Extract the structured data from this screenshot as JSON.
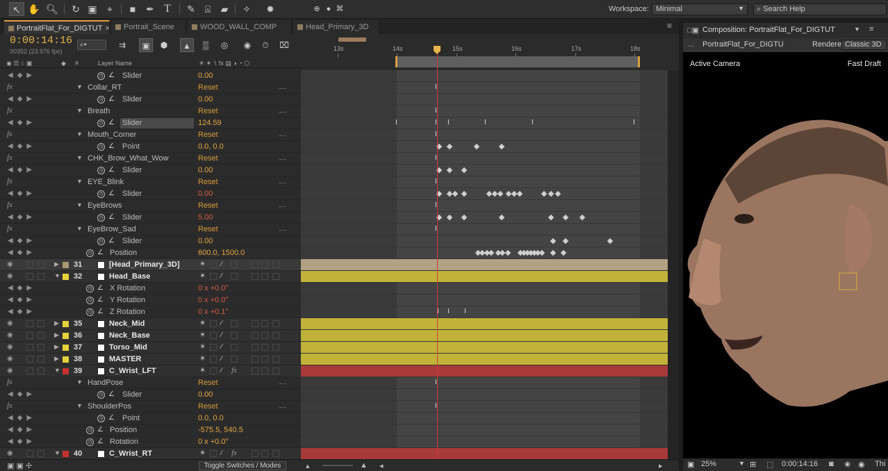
{
  "toolbar": {
    "tools": [
      "selection-tool",
      "hand-tool",
      "zoom-tool",
      "rotate-tool",
      "camera-tool",
      "pan-behind-tool",
      "rectangle-tool",
      "pen-tool",
      "type-tool",
      "brush-tool",
      "clone-stamp-tool",
      "eraser-tool",
      "roto-brush-tool",
      "puppet-pin-tool"
    ],
    "type_glyph": "T",
    "workspace_label": "Workspace:",
    "workspace_value": "Minimal",
    "search_help": "Search Help"
  },
  "tabs": [
    {
      "label": "PortraitFlat_For_DIGTUT",
      "active": true,
      "close": "×"
    },
    {
      "label": "Portrait_Scene"
    },
    {
      "label": "WOOD_WALL_COMP"
    },
    {
      "label": "Head_Primary_3D"
    }
  ],
  "timecode": "0:00:14:16",
  "timecode_sub": "00352 (23.976 fps)",
  "search_placeholder": "",
  "columns": {
    "hash": "#",
    "layer_name": "Layer Name"
  },
  "ruler": {
    "labels": [
      "13s",
      "14s",
      "15s",
      "16s",
      "17s",
      "18s"
    ]
  },
  "rows": [
    {
      "kind": "prop",
      "name": "Slider",
      "value": "0.00",
      "indent": 3,
      "graph": true,
      "stop": true
    },
    {
      "kind": "fx",
      "name": "Collar_RT",
      "value": "Reset"
    },
    {
      "kind": "prop",
      "name": "Slider",
      "value": "0.00",
      "indent": 3,
      "graph": true,
      "stop": true
    },
    {
      "kind": "fx",
      "name": "Breath",
      "value": "Reset"
    },
    {
      "kind": "prop",
      "name": "Slider",
      "value": "124.59",
      "indent": 3,
      "graph": true,
      "stop": true,
      "selected": true
    },
    {
      "kind": "fx",
      "name": "Mouth_Corner",
      "value": "Reset"
    },
    {
      "kind": "prop",
      "name": "Point",
      "value": "0.0, 0.0",
      "indent": 3,
      "graph": true,
      "stop": true
    },
    {
      "kind": "fx",
      "name": "CHK_Brow_What_Wow",
      "value": "Reset"
    },
    {
      "kind": "prop",
      "name": "Slider",
      "value": "0.00",
      "indent": 3,
      "graph": true,
      "stop": true
    },
    {
      "kind": "fx",
      "name": "EYE_Blink",
      "value": "Reset"
    },
    {
      "kind": "prop",
      "name": "Slider",
      "value": "0.00",
      "indent": 3,
      "graph": true,
      "stop": true,
      "red": true
    },
    {
      "kind": "fx",
      "name": "EyeBrows",
      "value": "Reset"
    },
    {
      "kind": "prop",
      "name": "Slider",
      "value": "5.00",
      "indent": 3,
      "graph": true,
      "stop": true,
      "red": true
    },
    {
      "kind": "fx",
      "name": "EyeBrow_Sad",
      "value": "Reset"
    },
    {
      "kind": "prop",
      "name": "Slider",
      "value": "0.00",
      "indent": 3,
      "graph": true,
      "stop": true
    },
    {
      "kind": "prop",
      "name": "Position",
      "value": "600.0, 1500.0",
      "indent": 2,
      "graph": true,
      "stop": true
    },
    {
      "kind": "layer",
      "num": "31",
      "name": "[Head_Primary_3D]",
      "label": "#a89870",
      "precomp": true
    },
    {
      "kind": "layer",
      "num": "32",
      "name": "Head_Base",
      "label": "#e6d23a",
      "open": true
    },
    {
      "kind": "prop",
      "name": "X Rotation",
      "value": "0 x +0.0°",
      "indent": 2,
      "graph": true,
      "stop": true,
      "red": true
    },
    {
      "kind": "prop",
      "name": "Y Rotation",
      "value": "0 x +0.0°",
      "indent": 2,
      "graph": true,
      "stop": true,
      "red": true
    },
    {
      "kind": "prop",
      "name": "Z Rotation",
      "value": "0 x +0.1°",
      "indent": 2,
      "graph": true,
      "stop": true,
      "red": true
    },
    {
      "kind": "layer",
      "num": "35",
      "name": "Neck_Mid",
      "label": "#e6d23a"
    },
    {
      "kind": "layer",
      "num": "36",
      "name": "Neck_Base",
      "label": "#e6d23a"
    },
    {
      "kind": "layer",
      "num": "37",
      "name": "Torso_Mid",
      "label": "#e6d23a"
    },
    {
      "kind": "layer",
      "num": "38",
      "name": "MASTER",
      "label": "#e6d23a"
    },
    {
      "kind": "layer",
      "num": "39",
      "name": "C_Wrist_LFT",
      "label": "#c83030",
      "open": true,
      "fx": true
    },
    {
      "kind": "fx",
      "name": "HandPose",
      "value": "Reset"
    },
    {
      "kind": "prop",
      "name": "Slider",
      "value": "0.00",
      "indent": 3,
      "graph": true,
      "stop": true
    },
    {
      "kind": "fx",
      "name": "ShoulderPos",
      "value": "Reset"
    },
    {
      "kind": "prop",
      "name": "Point",
      "value": "0.0, 0.0",
      "indent": 3,
      "graph": true,
      "stop": true
    },
    {
      "kind": "prop",
      "name": "Position",
      "value": "-575.5, 540.5",
      "indent": 2,
      "graph": true,
      "stop": true
    },
    {
      "kind": "prop",
      "name": "Rotation",
      "value": "0 x +0.0°",
      "indent": 2,
      "graph": true,
      "stop": true
    },
    {
      "kind": "layer",
      "num": "40",
      "name": "C_Wrist_RT",
      "label": "#c83030",
      "open": true,
      "fx": true
    }
  ],
  "track_bars": {
    "31": "#b3a184",
    "32": "#c1b33a",
    "35": "#c1b33a",
    "36": "#c1b33a",
    "37": "#c1b33a",
    "38": "#c1b33a",
    "39": "#a83a3a",
    "40": "#a83a3a"
  },
  "bottom": {
    "toggle_modes": "Toggle Switches / Modes"
  },
  "comp": {
    "tab_label": "Composition: PortraitFlat_For_DIGTUT",
    "name": "PortraitFlat_For_DIGTU",
    "renderer_label": "Renderer:",
    "renderer_value": "Classic 3D",
    "active_camera": "Active Camera",
    "fast_draft": "Fast Draft",
    "zoom": "25%",
    "timecode": "0:00:14:16",
    "trailing": "Thi"
  },
  "colors": {
    "accent": "#e6b64a",
    "cti": "#d03a3a",
    "value": "#e6a840",
    "keyed_value": "#d65a48"
  }
}
